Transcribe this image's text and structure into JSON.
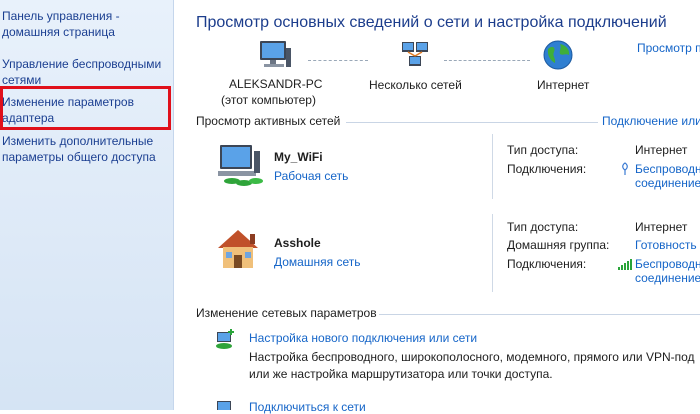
{
  "sidebar": {
    "links": [
      {
        "line1": "Панель управления -",
        "line2": "домашняя страница"
      },
      {
        "line1": "Управление беспроводными",
        "line2": "сетями"
      },
      {
        "line1": "Изменение параметров",
        "line2": "адаптера"
      },
      {
        "line1": "Изменить дополнительные",
        "line2": "параметры общего доступа"
      }
    ]
  },
  "header": {
    "title": "Просмотр основных сведений о сети и настройка подключений",
    "map_link": "Просмотр п"
  },
  "network_map": {
    "computer_name": "ALEKSANDR-PC",
    "computer_caption": "(этот компьютер)",
    "middle_label": "Несколько сетей",
    "internet_label": "Интернет"
  },
  "active_networks": {
    "heading": "Просмотр активных сетей",
    "link": "Подключение или",
    "networks": [
      {
        "name": "My_WiFi",
        "type": "Рабочая сеть",
        "access_label": "Тип доступа:",
        "access_value": "Интернет",
        "conn_label": "Подключения:",
        "conn_value_1": "Беспроводн",
        "conn_value_2": "соединение"
      },
      {
        "name": "Asshole",
        "type": "Домашняя сеть",
        "access_label": "Тип доступа:",
        "access_value": "Интернет",
        "group_label": "Домашняя группа:",
        "group_value": "Готовность",
        "conn_label": "Подключения:",
        "conn_value_1": "Беспроводн",
        "conn_value_2": "соединение"
      }
    ]
  },
  "change_settings": {
    "heading": "Изменение сетевых параметров",
    "items": [
      {
        "title": "Настройка нового подключения или сети",
        "desc_1": "Настройка беспроводного, широкополосного, модемного, прямого или VPN-под",
        "desc_2": "или же настройка маршрутизатора или точки доступа."
      },
      {
        "title": "Подключиться к сети",
        "desc_1": "",
        "desc_2": ""
      }
    ]
  },
  "colors": {
    "link": "#1565c8",
    "sidebar_link": "#1b3f91",
    "highlight": "#e0101b",
    "title": "#1c3d8c"
  }
}
